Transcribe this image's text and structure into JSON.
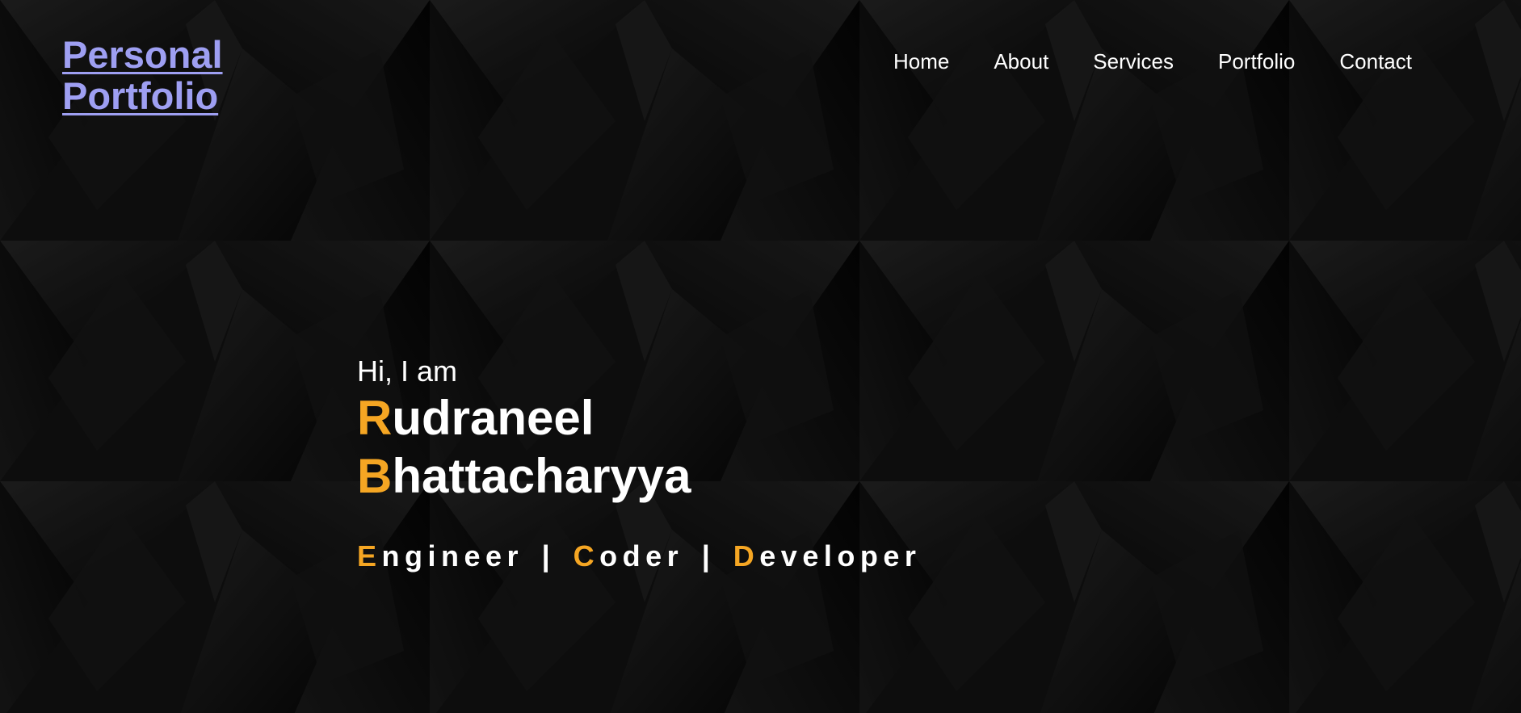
{
  "logo": {
    "line1": "Personal",
    "line2": "Portfolio"
  },
  "nav": {
    "items": [
      "Home",
      "About",
      "Services",
      "Portfolio",
      "Contact"
    ]
  },
  "hero": {
    "greeting": "Hi, I am",
    "first_name_initial": "R",
    "first_name_rest": "udraneel",
    "last_name_initial": "B",
    "last_name_rest": "hattacharyya",
    "roles": [
      {
        "initial": "E",
        "rest": "ngineer"
      },
      {
        "initial": "C",
        "rest": "oder"
      },
      {
        "initial": "D",
        "rest": "eveloper"
      }
    ],
    "separator": "|"
  },
  "colors": {
    "logo": "#9e9ff2",
    "accent": "#f5a623",
    "text": "#ffffff",
    "background": "#0c0c0c"
  }
}
